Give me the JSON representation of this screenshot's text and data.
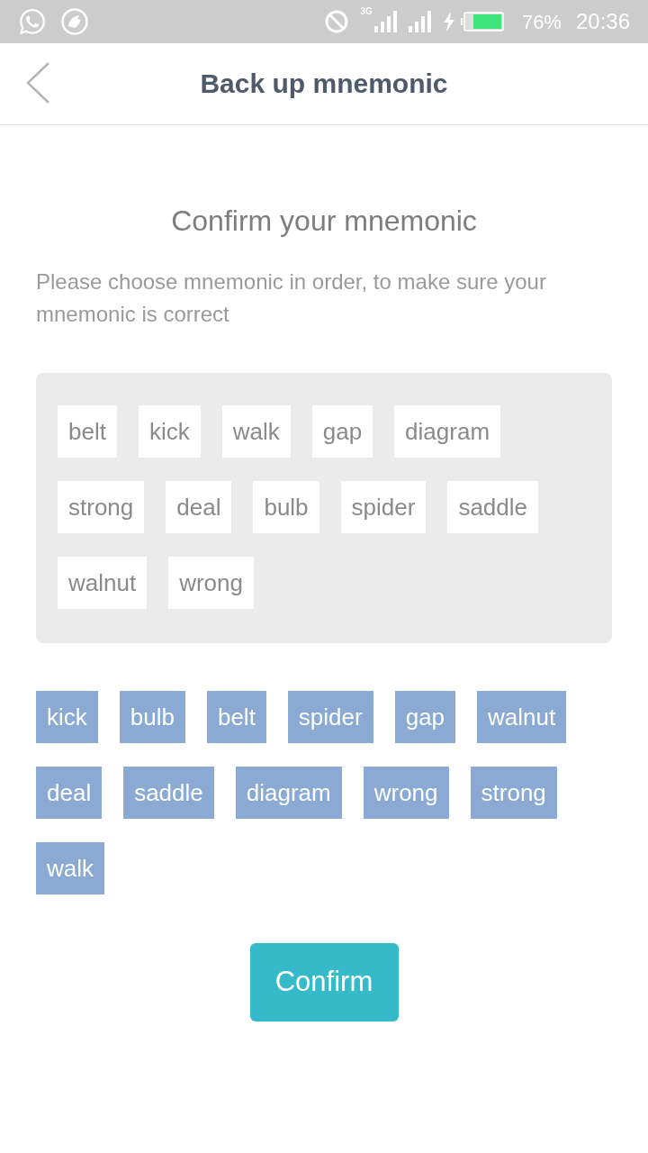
{
  "status_bar": {
    "network_type": "3G",
    "battery": "76%",
    "time": "20:36"
  },
  "header": {
    "title": "Back up mnemonic"
  },
  "heading": "Confirm your mnemonic",
  "description": "Please choose mnemonic in order, to make sure your mnemonic is correct",
  "selected_words": [
    "belt",
    "kick",
    "walk",
    "gap",
    "diagram",
    "strong",
    "deal",
    "bulb",
    "spider",
    "saddle",
    "walnut",
    "wrong"
  ],
  "word_choices": [
    "kick",
    "bulb",
    "belt",
    "spider",
    "gap",
    "walnut",
    "deal",
    "saddle",
    "diagram",
    "wrong",
    "strong",
    "walk"
  ],
  "confirm_button": "Confirm"
}
